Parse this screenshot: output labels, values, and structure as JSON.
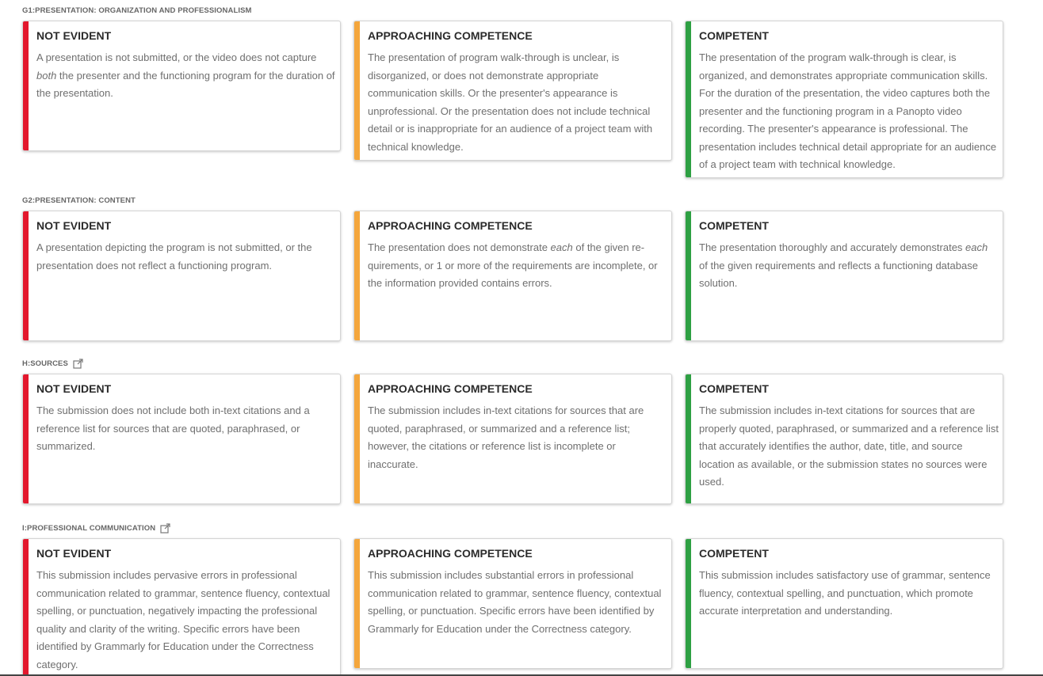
{
  "colors": {
    "not_evident": "#e3182d",
    "approaching": "#f4a63c",
    "competent": "#2ea043"
  },
  "sections": [
    {
      "header": "G1:PRESENTATION: ORGANIZATION AND PROFESSIONALISM",
      "cards": [
        {
          "title": "NOT EVIDENT",
          "desc": "A presentation is not submitted, or the video does not capture both the presenter and the functioning program for the duration of the presentation."
        },
        {
          "title": "APPROACHING COMPETENCE",
          "desc": "The presentation of program walk-through is unclear, is disorganized, or does not demonstrate appropriate communication skills. Or the presenter's appearance is unprofessional. Or the presentation does not include technical detail or is inappropriate for an audience of a project team with technical knowledge."
        },
        {
          "title": "COMPETENT",
          "desc": "The presentation of the program walk-through is clear, is organized, and demonstrates appropriate communication skills. For the duration of the presentation, the video captures both the presenter and the functioning program in a Panopto video recording. The presenter's appearance is professional. The presentation includes technical detail appropriate for an audience of a project team with technical knowledge."
        }
      ]
    },
    {
      "header": "G2:PRESENTATION: CONTENT",
      "cards": [
        {
          "title": "NOT EVIDENT",
          "desc": "A presentation depicting the program is not submitted, or the presentation does not reflect a functioning program."
        },
        {
          "title": "APPROACHING COMPETENCE",
          "desc": "The presentation does not demonstrate each of the given requirements, or 1 or more of the requirements are incomplete, or the information provided contains errors."
        },
        {
          "title": "COMPETENT",
          "desc": "The presentation thoroughly and accurately demonstrates each of the given requirements and reflects a functioning database solution."
        }
      ]
    },
    {
      "header": "H:SOURCES",
      "cards": [
        {
          "title": "NOT EVIDENT",
          "desc": "The submission does not include both in-text citations and a reference list for sources that are quoted, paraphrased, or summarized."
        },
        {
          "title": "APPROACHING COMPETENCE",
          "desc": "The submission includes in-text citations for sources that are quoted, paraphrased, or summarized and a reference list; however, the citations or reference list is incomplete or inaccurate."
        },
        {
          "title": "COMPETENT",
          "desc": "The submission includes in-text citations for sources that are properly quoted, paraphrased, or summarized and a reference list that accurately identifies the author, date, title, and source location as available, or the submission states no sources were used."
        }
      ]
    },
    {
      "header": "I:PROFESSIONAL COMMUNICATION",
      "cards": [
        {
          "title": "NOT EVIDENT",
          "desc": "This submission includes pervasive errors in professional communication related to grammar, sentence fluency, contextual spelling, or punctuation, negatively impacting the professional quality and clarity of the writing. Specific errors have been identified by Grammarly for Education under the Correctness category."
        },
        {
          "title": "APPROACHING COMPETENCE",
          "desc": "This submission includes substantial errors in professional communication related to grammar, sentence fluency, contextual spelling, or punctuation. Specific errors have been identified by Grammarly for Education under the Correctness category."
        },
        {
          "title": "COMPETENT",
          "desc": "This submission includes satisfactory use of grammar, sentence fluency, contextual spelling, and punctuation, which promote accurate interpretation and understanding."
        }
      ]
    }
  ]
}
